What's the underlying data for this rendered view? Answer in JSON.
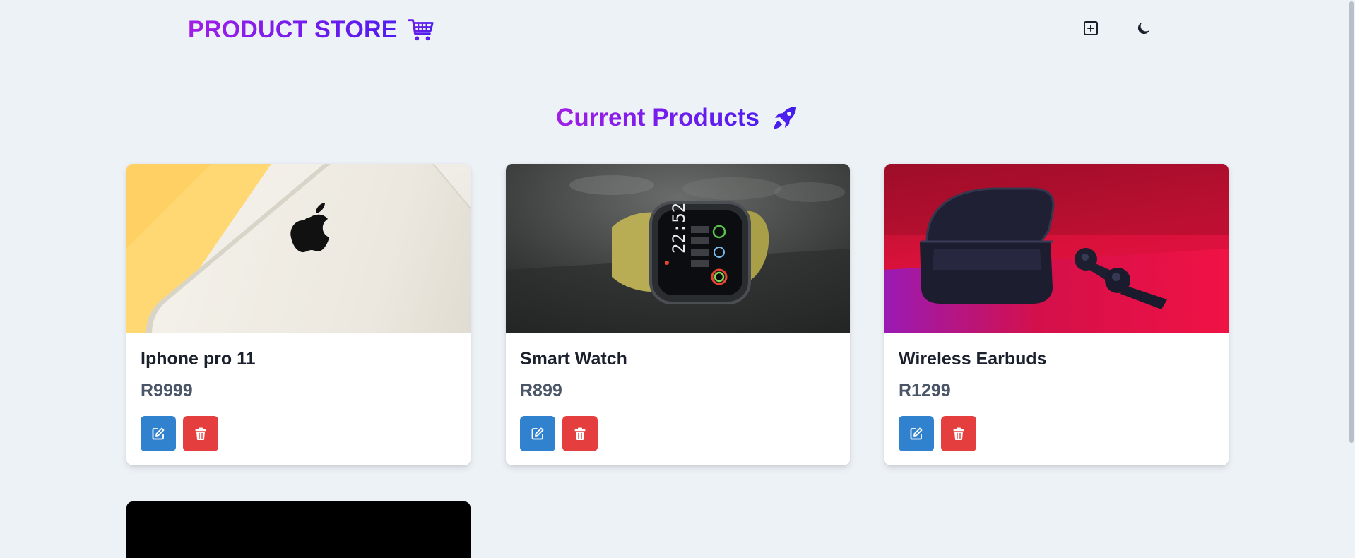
{
  "navbar": {
    "brand": "PRODUCT STORE",
    "brand_icon": "shopping-cart-icon",
    "add_button_icon": "plus-square-icon",
    "theme_button_icon": "moon-icon"
  },
  "main": {
    "title": "Current Products",
    "title_icon": "rocket-icon"
  },
  "products": [
    {
      "name": "Iphone pro 11",
      "price": "R9999",
      "image": "iphone-image"
    },
    {
      "name": "Smart Watch",
      "price": "R899",
      "image": "smartwatch-image"
    },
    {
      "name": "Wireless Earbuds",
      "price": "R1299",
      "image": "earbuds-image"
    }
  ],
  "card_actions": {
    "edit_icon": "edit-icon",
    "delete_icon": "trash-icon"
  },
  "colors": {
    "gradient_start": "#a11ee6",
    "gradient_end": "#4f1cf0",
    "background": "#edf2f7",
    "edit_button": "#3182ce",
    "delete_button": "#e53e3e",
    "price_text": "#4a5568"
  }
}
